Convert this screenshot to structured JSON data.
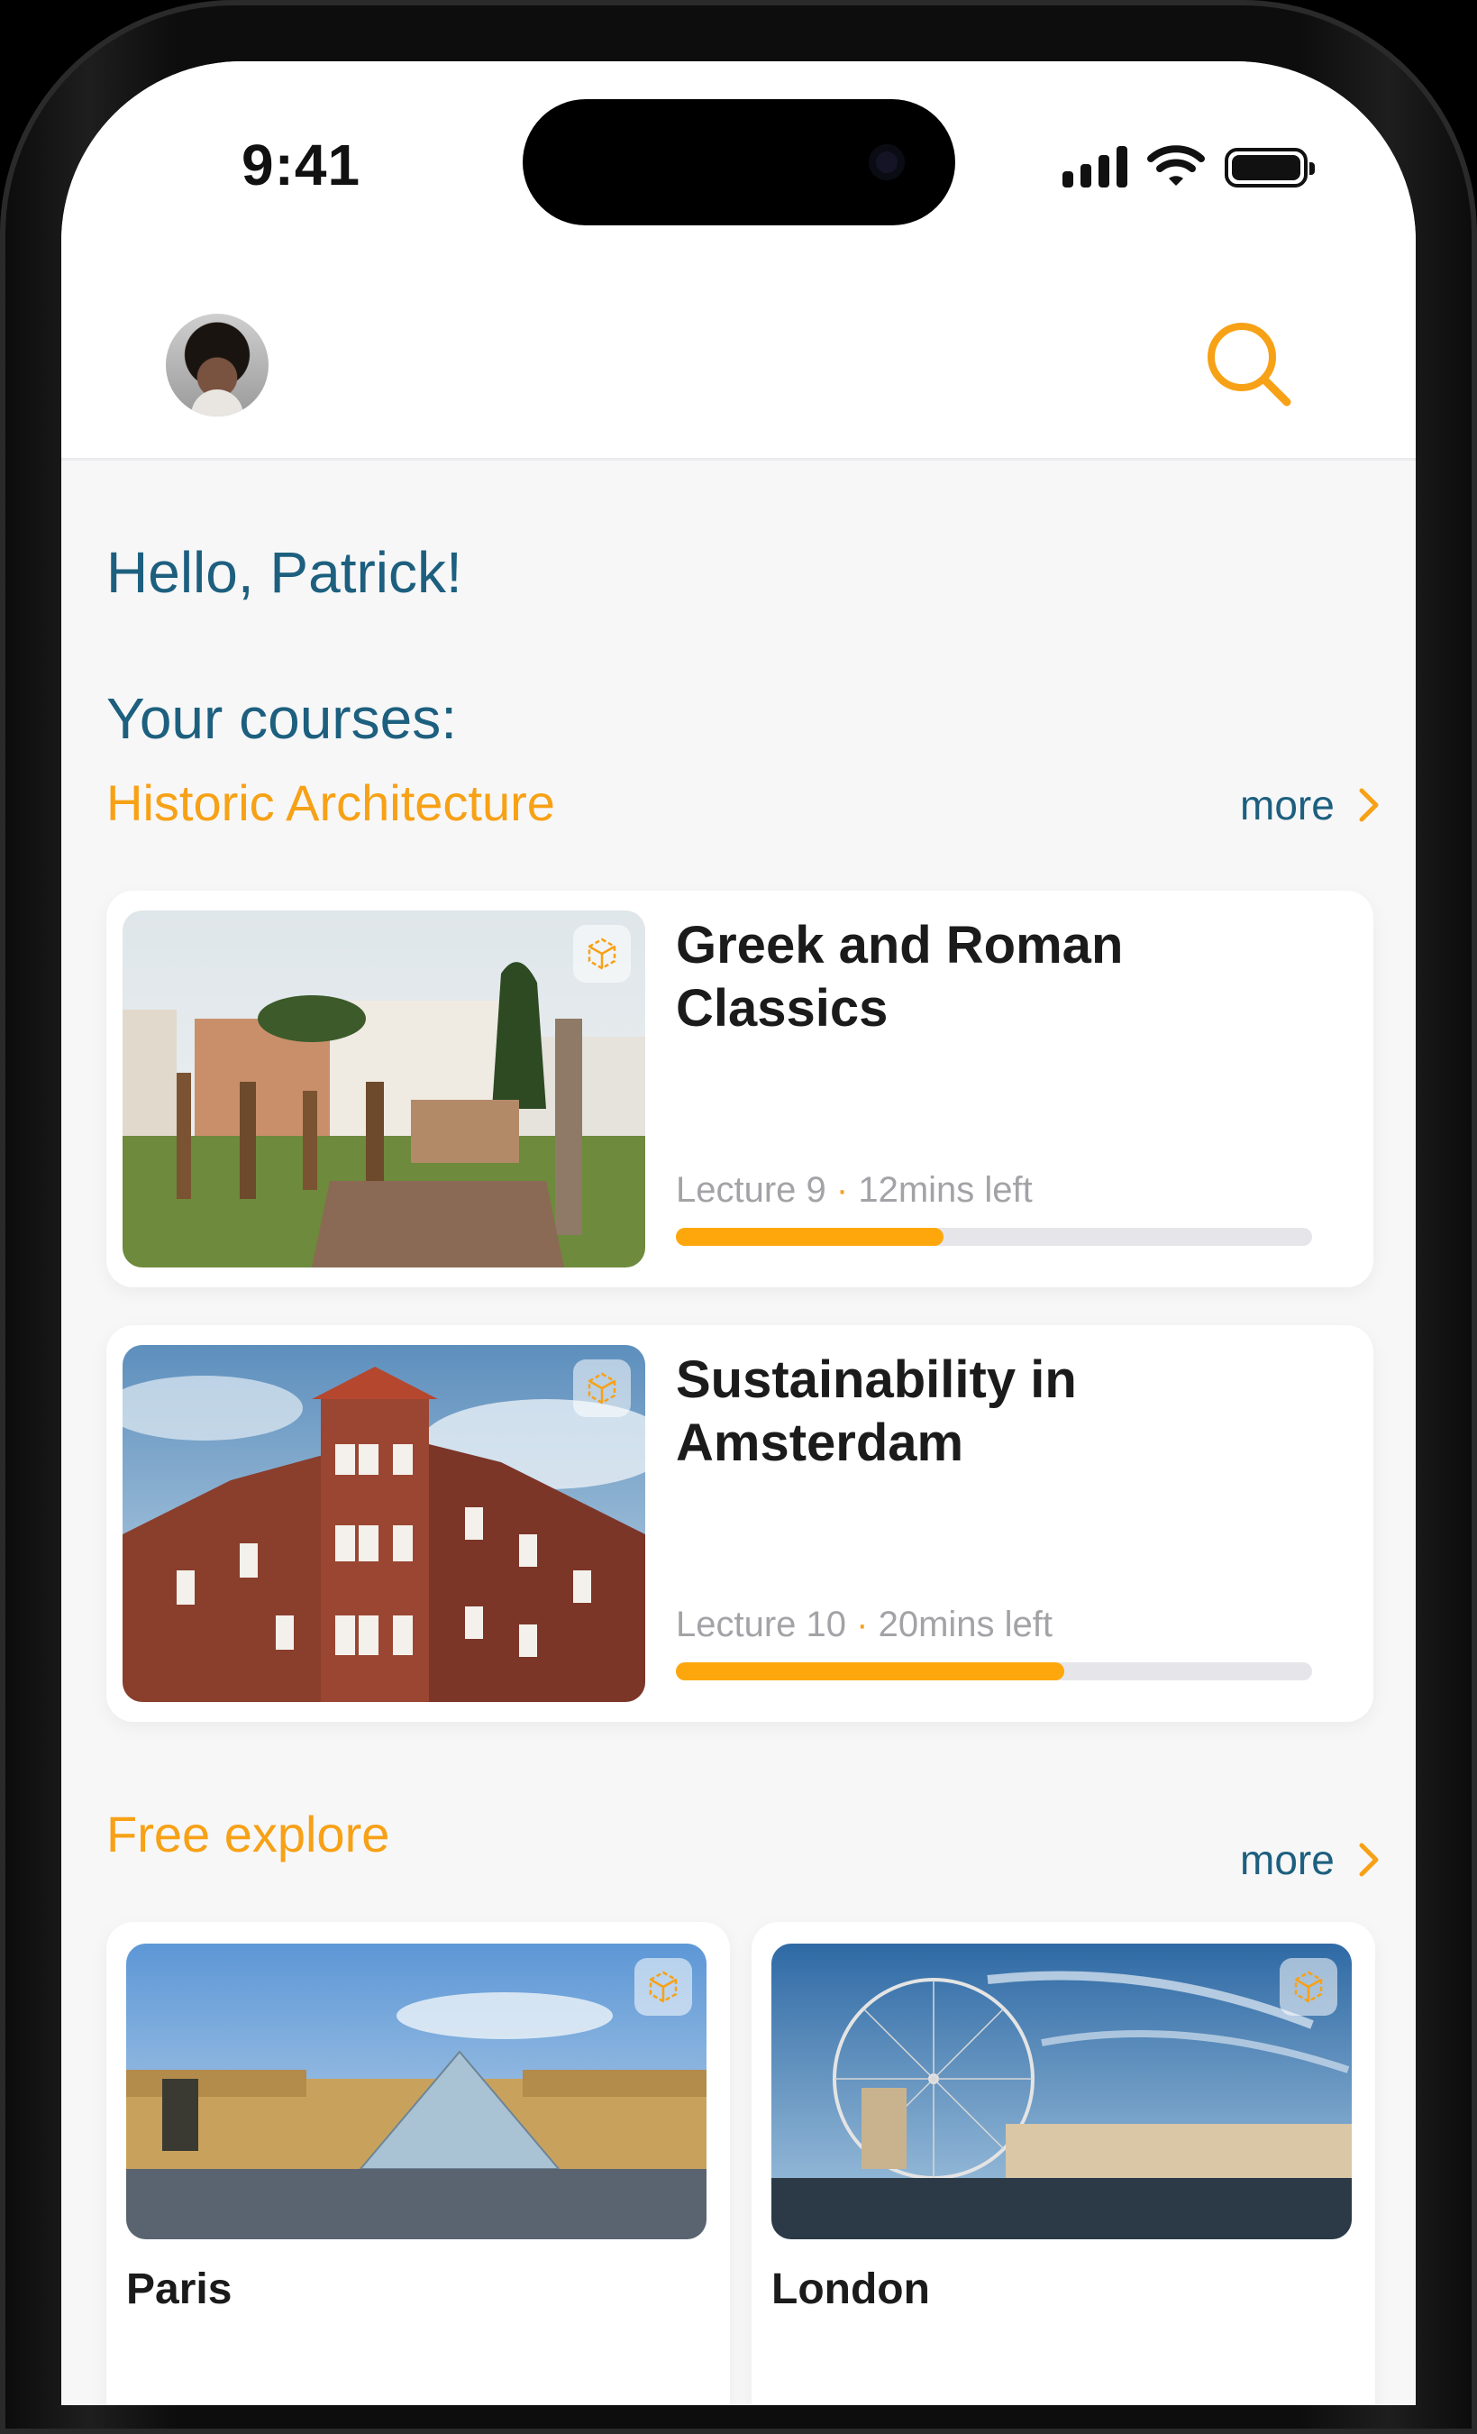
{
  "status_bar": {
    "time": "9:41"
  },
  "header": {
    "avatar_alt": "profile-avatar",
    "search_icon": "search-icon"
  },
  "greeting": "Hello,  Patrick!",
  "courses_heading": "Your courses:",
  "courses_section": {
    "title": "Historic Architecture",
    "more_label": "more",
    "items": [
      {
        "title": "Greek and Roman Classics",
        "lecture": "Lecture 9",
        "time_left": "12mins left",
        "progress": 0.42
      },
      {
        "title": "Sustainability in Amsterdam",
        "lecture": "Lecture 10",
        "time_left": "20mins left",
        "progress": 0.61
      }
    ]
  },
  "explore_section": {
    "title": "Free explore",
    "more_label": "more",
    "items": [
      {
        "label": "Paris"
      },
      {
        "label": "London"
      }
    ]
  },
  "colors": {
    "accent_orange": "#f7a116",
    "heading_blue": "#1d5f7e",
    "progress_fill": "#fea70d"
  }
}
